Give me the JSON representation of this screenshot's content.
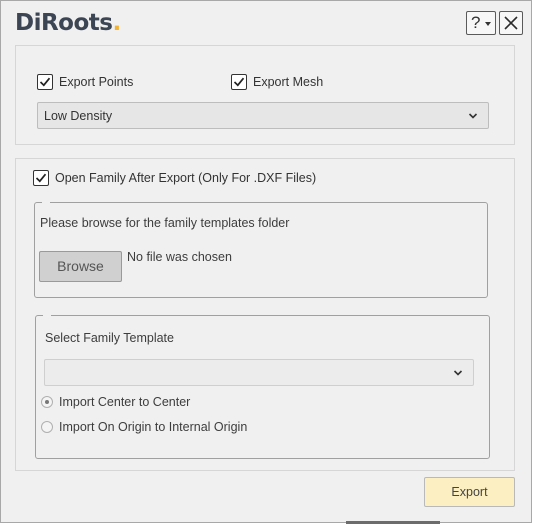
{
  "header": {
    "logo_text": "DiRoots",
    "logo_dot": ".",
    "help_label": "?"
  },
  "export_options": {
    "export_points_label": "Export Points",
    "export_points_checked": true,
    "export_mesh_label": "Export Mesh",
    "export_mesh_checked": true,
    "density_value": "Low Density"
  },
  "family": {
    "open_family_label": "Open Family After Export (Only For .DXF Files)",
    "open_family_checked": true,
    "browse_prompt": "Please browse for the family templates folder",
    "browse_button_label": "Browse",
    "file_status": "No file was chosen",
    "select_template_label": "Select Family Template",
    "template_value": "",
    "radio_options": [
      {
        "label": "Import Center to Center",
        "selected": true
      },
      {
        "label": "Import On Origin to Internal Origin",
        "selected": false
      }
    ]
  },
  "footer": {
    "export_button_label": "Export"
  },
  "colors": {
    "export_button_bg": "#fcefc2",
    "logo_dot": "#f2b233",
    "logo_text": "#3b4553"
  }
}
